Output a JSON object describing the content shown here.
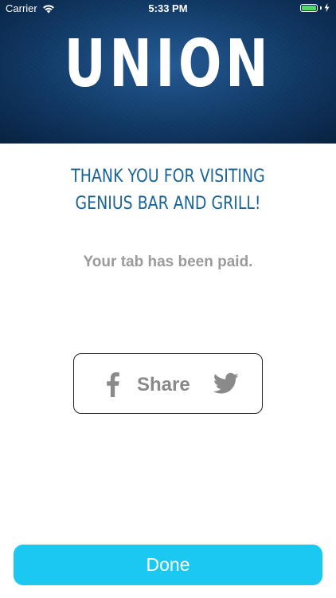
{
  "status_bar": {
    "carrier": "Carrier",
    "time": "5:33 PM",
    "battery_level_percent": 100,
    "battery_color": "#4cd964"
  },
  "header": {
    "logo_text": "UNION",
    "background_color": "#123d6c"
  },
  "message": {
    "line1": "THANK YOU FOR VISITING",
    "line2": "GENIUS BAR AND GRILL!",
    "color": "#1a6496",
    "status": "Your tab has been paid."
  },
  "share": {
    "label": "Share",
    "icons": [
      "facebook-icon",
      "twitter-icon"
    ]
  },
  "footer": {
    "done_label": "Done",
    "done_color": "#1ac8f0"
  }
}
